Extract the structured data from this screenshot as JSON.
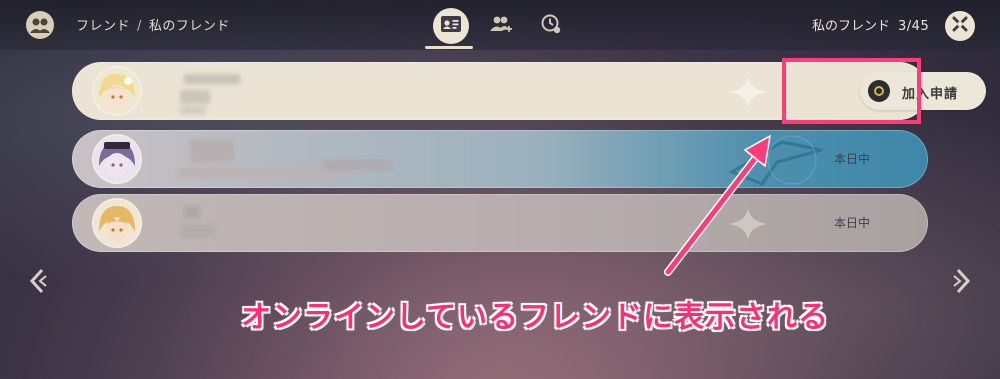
{
  "header": {
    "breadcrumb_root": "フレンド",
    "breadcrumb_sep": "/",
    "breadcrumb_current": "私のフレンド",
    "tabs": [
      {
        "icon": "friend-card-icon",
        "active": true
      },
      {
        "icon": "add-friend-icon",
        "active": false
      },
      {
        "icon": "recent-clock-icon",
        "active": false
      }
    ],
    "friend_count_label": "私のフレンド",
    "friend_count_value": "3/45"
  },
  "friends": [
    {
      "avatar": "lumine-avatar",
      "status": "",
      "action_label": "加入申請"
    },
    {
      "avatar": "qiqi-avatar",
      "status": "本日中"
    },
    {
      "avatar": "aether-avatar",
      "status": "本日中"
    }
  ],
  "annotation": {
    "text": "オンラインしているフレンドに表示される",
    "color": "#ff2e73"
  },
  "colors": {
    "accent_pink": "#ff3b7a",
    "card_light": "#ebe3d3",
    "card_online": "#3e86a8"
  }
}
